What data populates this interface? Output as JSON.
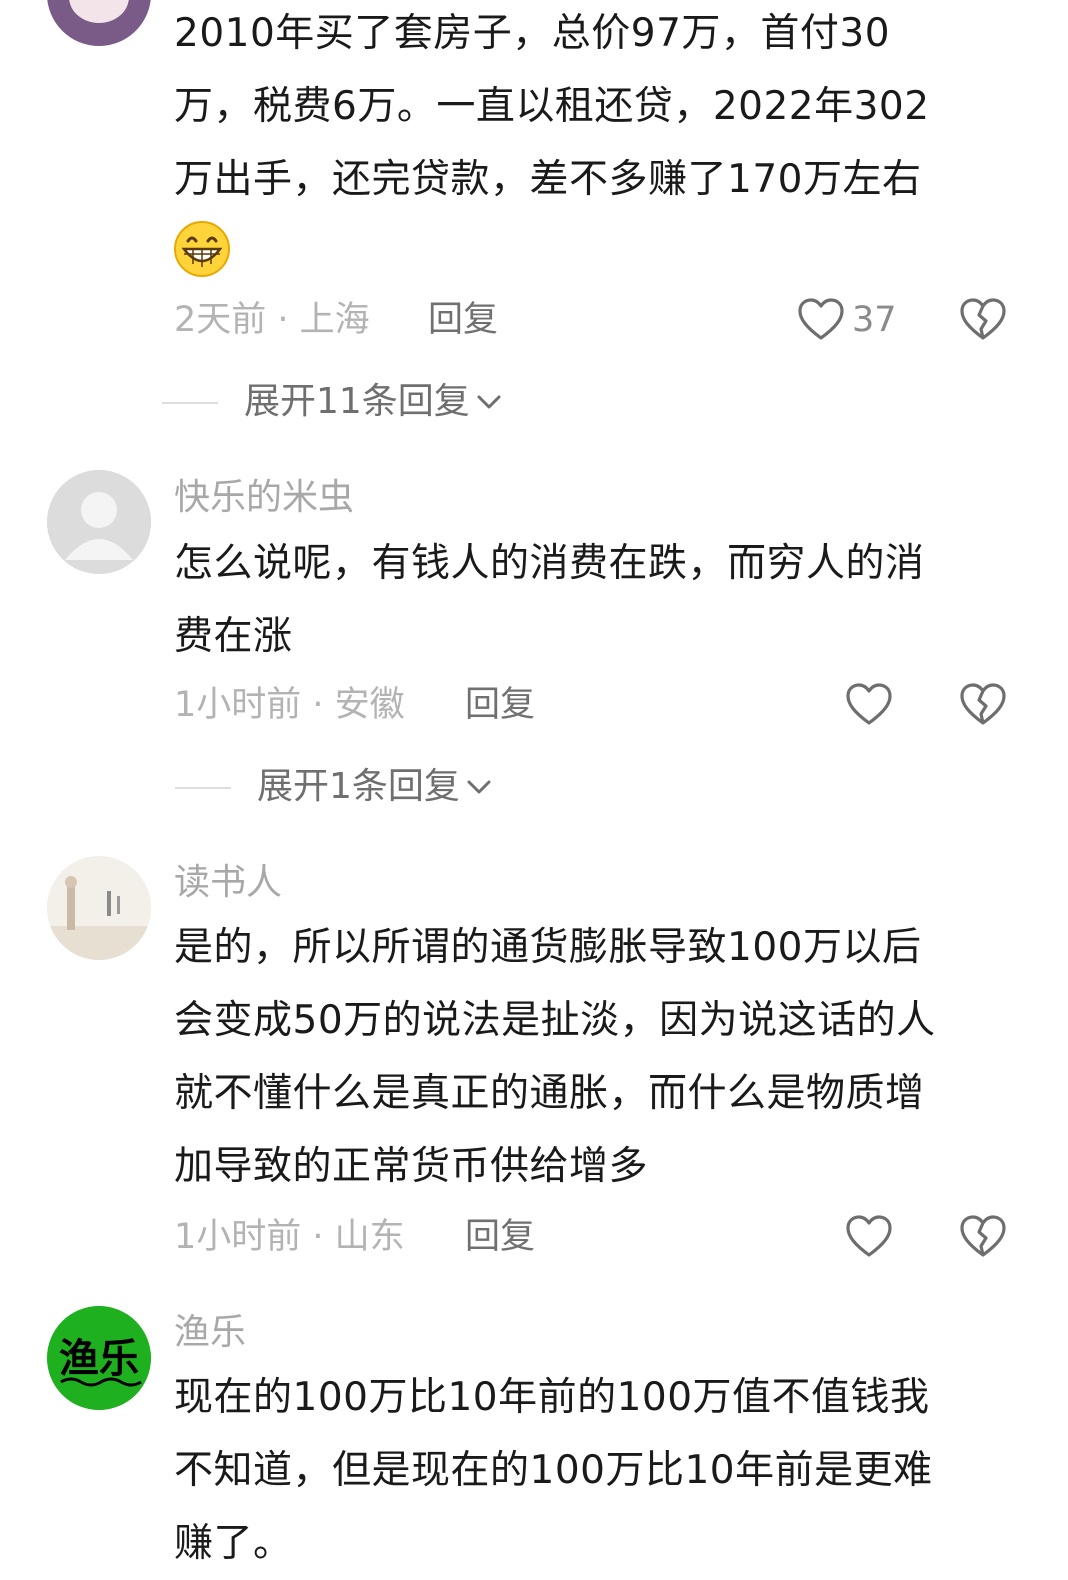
{
  "comments": [
    {
      "username": "",
      "lines": [
        "2010年买了套房子，总价97万，首付30",
        "万，税费6万。一直以租还贷，2022年302",
        "万出手，还完贷款，差不多赚了170万左右"
      ],
      "emoji": "😁",
      "meta": "2天前 · 上海",
      "reply_label": "回复",
      "like_count": "37",
      "expand_label": "展开11条回复"
    },
    {
      "username": "快乐的米虫",
      "lines": [
        "怎么说呢，有钱人的消费在跌，而穷人的消",
        "费在涨"
      ],
      "meta": "1小时前 · 安徽",
      "reply_label": "回复",
      "like_count": "",
      "expand_label": "展开1条回复"
    },
    {
      "username": "读书人",
      "lines": [
        "是的，所以所谓的通货膨胀导致100万以后",
        "会变成50万的说法是扯淡，因为说这话的人",
        "就不懂什么是真正的通胀，而什么是物质增",
        "加导致的正常货币供给增多"
      ],
      "meta": "1小时前 · 山东",
      "reply_label": "回复",
      "like_count": ""
    },
    {
      "username": "渔乐",
      "avatar_text": "渔乐",
      "lines": [
        "现在的100万比10年前的100万值不值钱我",
        "不知道，但是现在的100万比10年前是更难",
        "赚了。"
      ]
    }
  ],
  "colors": {
    "username": "#a8a8a8",
    "meta": "#b3b3b3",
    "text": "#1a1a1a",
    "avatar_green": "#1fb01f"
  },
  "icons": {
    "like": "heart-outline-icon",
    "dislike": "broken-heart-icon",
    "expand": "chevron-down-icon"
  }
}
